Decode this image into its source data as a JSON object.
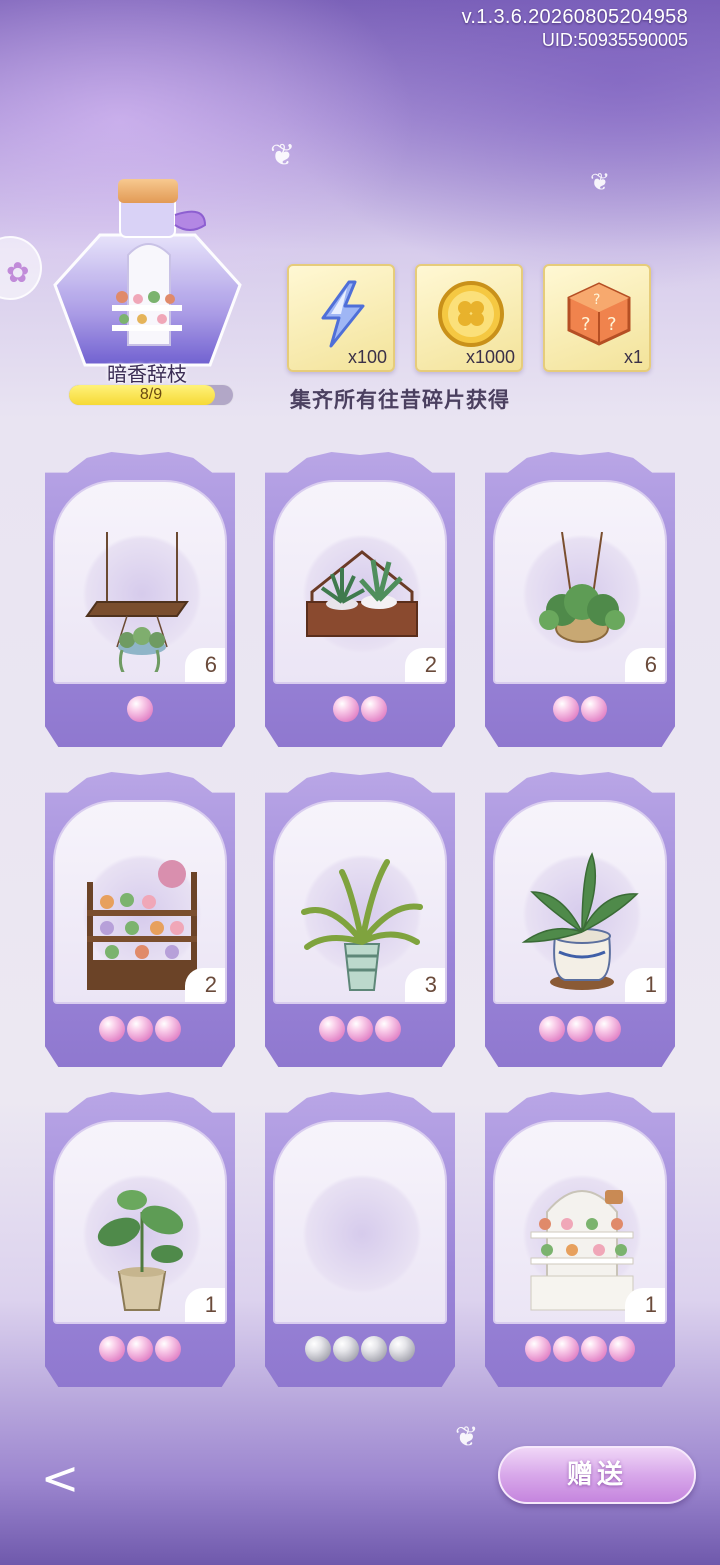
{
  "header": {
    "version": "v.1.3.6.20260805204958",
    "uid": "UID:50935590005"
  },
  "collection": {
    "name": "暗香辞枝",
    "progress_text": "8/9",
    "progress_fraction": 0.889
  },
  "rewards": [
    {
      "icon": "lightning-icon",
      "qty": "x100"
    },
    {
      "icon": "gold-coin-icon",
      "qty": "x1000"
    },
    {
      "icon": "mystery-box-icon",
      "qty": "x1"
    }
  ],
  "reward_caption": "集齐所有往昔碎片获得",
  "cards": [
    {
      "item": "hanging-planter",
      "count": "6",
      "rarity": 1,
      "pearl": "pink"
    },
    {
      "item": "terrarium-planter",
      "count": "2",
      "rarity": 2,
      "pearl": "pink"
    },
    {
      "item": "hanging-fern-basket",
      "count": "6",
      "rarity": 2,
      "pearl": "pink"
    },
    {
      "item": "flower-shelf",
      "count": "2",
      "rarity": 3,
      "pearl": "pink"
    },
    {
      "item": "striped-vase-plant",
      "count": "3",
      "rarity": 3,
      "pearl": "pink"
    },
    {
      "item": "porcelain-pot-plant",
      "count": "1",
      "rarity": 3,
      "pearl": "pink"
    },
    {
      "item": "monstera-pot",
      "count": "1",
      "rarity": 3,
      "pearl": "pink"
    },
    {
      "item": "empty-slot",
      "count": "",
      "rarity": 4,
      "pearl": "grey"
    },
    {
      "item": "flower-cabinet",
      "count": "1",
      "rarity": 4,
      "pearl": "pink"
    }
  ],
  "footer": {
    "back_label": "<",
    "gift_label": "赠送"
  },
  "colors": {
    "card_frame": "#9a84d8",
    "pearl_pink": "#e58ccb",
    "pearl_grey": "#a9a9b3",
    "gift_button": "#d8a8ea",
    "progress_fill": "#f6d936"
  }
}
